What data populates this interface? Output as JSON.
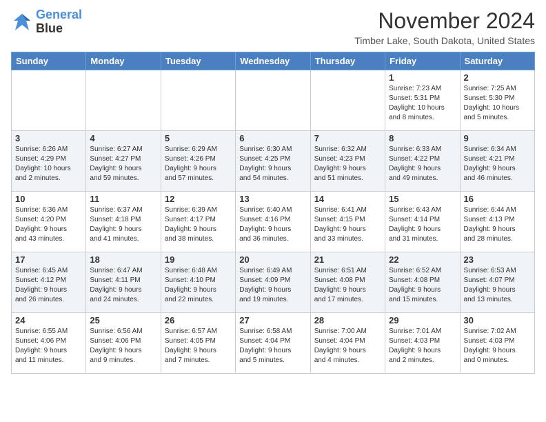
{
  "header": {
    "logo_line1": "General",
    "logo_line2": "Blue",
    "month_title": "November 2024",
    "location": "Timber Lake, South Dakota, United States"
  },
  "columns": [
    "Sunday",
    "Monday",
    "Tuesday",
    "Wednesday",
    "Thursday",
    "Friday",
    "Saturday"
  ],
  "weeks": [
    [
      {
        "day": "",
        "info": ""
      },
      {
        "day": "",
        "info": ""
      },
      {
        "day": "",
        "info": ""
      },
      {
        "day": "",
        "info": ""
      },
      {
        "day": "",
        "info": ""
      },
      {
        "day": "1",
        "info": "Sunrise: 7:23 AM\nSunset: 5:31 PM\nDaylight: 10 hours\nand 8 minutes."
      },
      {
        "day": "2",
        "info": "Sunrise: 7:25 AM\nSunset: 5:30 PM\nDaylight: 10 hours\nand 5 minutes."
      }
    ],
    [
      {
        "day": "3",
        "info": "Sunrise: 6:26 AM\nSunset: 4:29 PM\nDaylight: 10 hours\nand 2 minutes."
      },
      {
        "day": "4",
        "info": "Sunrise: 6:27 AM\nSunset: 4:27 PM\nDaylight: 9 hours\nand 59 minutes."
      },
      {
        "day": "5",
        "info": "Sunrise: 6:29 AM\nSunset: 4:26 PM\nDaylight: 9 hours\nand 57 minutes."
      },
      {
        "day": "6",
        "info": "Sunrise: 6:30 AM\nSunset: 4:25 PM\nDaylight: 9 hours\nand 54 minutes."
      },
      {
        "day": "7",
        "info": "Sunrise: 6:32 AM\nSunset: 4:23 PM\nDaylight: 9 hours\nand 51 minutes."
      },
      {
        "day": "8",
        "info": "Sunrise: 6:33 AM\nSunset: 4:22 PM\nDaylight: 9 hours\nand 49 minutes."
      },
      {
        "day": "9",
        "info": "Sunrise: 6:34 AM\nSunset: 4:21 PM\nDaylight: 9 hours\nand 46 minutes."
      }
    ],
    [
      {
        "day": "10",
        "info": "Sunrise: 6:36 AM\nSunset: 4:20 PM\nDaylight: 9 hours\nand 43 minutes."
      },
      {
        "day": "11",
        "info": "Sunrise: 6:37 AM\nSunset: 4:18 PM\nDaylight: 9 hours\nand 41 minutes."
      },
      {
        "day": "12",
        "info": "Sunrise: 6:39 AM\nSunset: 4:17 PM\nDaylight: 9 hours\nand 38 minutes."
      },
      {
        "day": "13",
        "info": "Sunrise: 6:40 AM\nSunset: 4:16 PM\nDaylight: 9 hours\nand 36 minutes."
      },
      {
        "day": "14",
        "info": "Sunrise: 6:41 AM\nSunset: 4:15 PM\nDaylight: 9 hours\nand 33 minutes."
      },
      {
        "day": "15",
        "info": "Sunrise: 6:43 AM\nSunset: 4:14 PM\nDaylight: 9 hours\nand 31 minutes."
      },
      {
        "day": "16",
        "info": "Sunrise: 6:44 AM\nSunset: 4:13 PM\nDaylight: 9 hours\nand 28 minutes."
      }
    ],
    [
      {
        "day": "17",
        "info": "Sunrise: 6:45 AM\nSunset: 4:12 PM\nDaylight: 9 hours\nand 26 minutes."
      },
      {
        "day": "18",
        "info": "Sunrise: 6:47 AM\nSunset: 4:11 PM\nDaylight: 9 hours\nand 24 minutes."
      },
      {
        "day": "19",
        "info": "Sunrise: 6:48 AM\nSunset: 4:10 PM\nDaylight: 9 hours\nand 22 minutes."
      },
      {
        "day": "20",
        "info": "Sunrise: 6:49 AM\nSunset: 4:09 PM\nDaylight: 9 hours\nand 19 minutes."
      },
      {
        "day": "21",
        "info": "Sunrise: 6:51 AM\nSunset: 4:08 PM\nDaylight: 9 hours\nand 17 minutes."
      },
      {
        "day": "22",
        "info": "Sunrise: 6:52 AM\nSunset: 4:08 PM\nDaylight: 9 hours\nand 15 minutes."
      },
      {
        "day": "23",
        "info": "Sunrise: 6:53 AM\nSunset: 4:07 PM\nDaylight: 9 hours\nand 13 minutes."
      }
    ],
    [
      {
        "day": "24",
        "info": "Sunrise: 6:55 AM\nSunset: 4:06 PM\nDaylight: 9 hours\nand 11 minutes."
      },
      {
        "day": "25",
        "info": "Sunrise: 6:56 AM\nSunset: 4:06 PM\nDaylight: 9 hours\nand 9 minutes."
      },
      {
        "day": "26",
        "info": "Sunrise: 6:57 AM\nSunset: 4:05 PM\nDaylight: 9 hours\nand 7 minutes."
      },
      {
        "day": "27",
        "info": "Sunrise: 6:58 AM\nSunset: 4:04 PM\nDaylight: 9 hours\nand 5 minutes."
      },
      {
        "day": "28",
        "info": "Sunrise: 7:00 AM\nSunset: 4:04 PM\nDaylight: 9 hours\nand 4 minutes."
      },
      {
        "day": "29",
        "info": "Sunrise: 7:01 AM\nSunset: 4:03 PM\nDaylight: 9 hours\nand 2 minutes."
      },
      {
        "day": "30",
        "info": "Sunrise: 7:02 AM\nSunset: 4:03 PM\nDaylight: 9 hours\nand 0 minutes."
      }
    ]
  ]
}
